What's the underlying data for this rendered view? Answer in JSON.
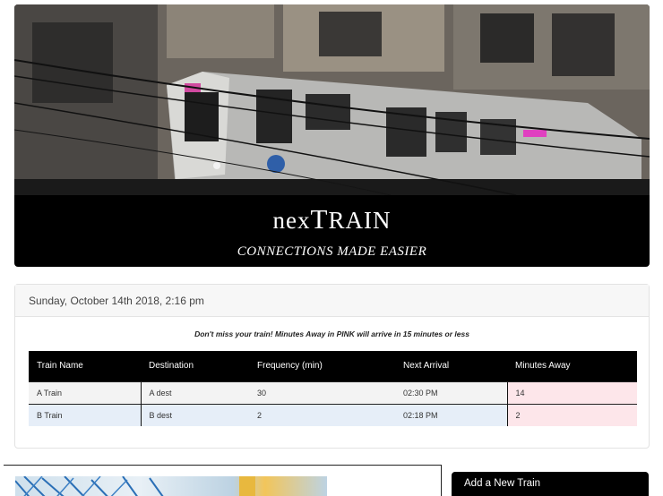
{
  "hero": {
    "title_first": "nex",
    "title_big": "T",
    "title_rest": "rain",
    "subtitle": "CONNECTIONS MADE EASIER",
    "image": "train-photo"
  },
  "schedule": {
    "current_time": "Sunday, October 14th 2018, 2:16 pm",
    "notice": "Don't miss your train! Minutes Away in PINK will arrive in 15 minutes or less",
    "columns": [
      "Train Name",
      "Destination",
      "Frequency (min)",
      "Next Arrival",
      "Minutes Away"
    ],
    "rows": [
      {
        "name": "A Train",
        "destination": "A dest",
        "frequency": "30",
        "next_arrival": "02:30 PM",
        "minutes_away": "14"
      },
      {
        "name": "B Train",
        "destination": "B dest",
        "frequency": "2",
        "next_arrival": "02:18 PM",
        "minutes_away": "2"
      }
    ],
    "soon_color": "#fde6ea"
  },
  "add_train": {
    "title": "Add a New Train"
  }
}
